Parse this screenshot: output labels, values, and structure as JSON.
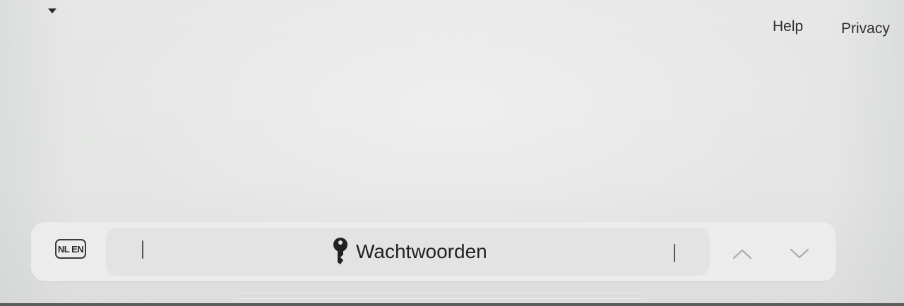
{
  "header": {
    "links": [
      {
        "label": "Help"
      },
      {
        "label": "Privacy"
      }
    ]
  },
  "keyboard_bar": {
    "language_badge": "NL EN",
    "passwords_label": "Wachtwoorden",
    "icons": {
      "menu": "caret-down-icon",
      "passwords": "key-icon",
      "previous": "chevron-up-icon",
      "next": "chevron-down-icon"
    }
  },
  "colors": {
    "background": "#e5e6e5",
    "bar": "#ebeceb",
    "pill": "#e2e3e2",
    "text": "#222222"
  }
}
